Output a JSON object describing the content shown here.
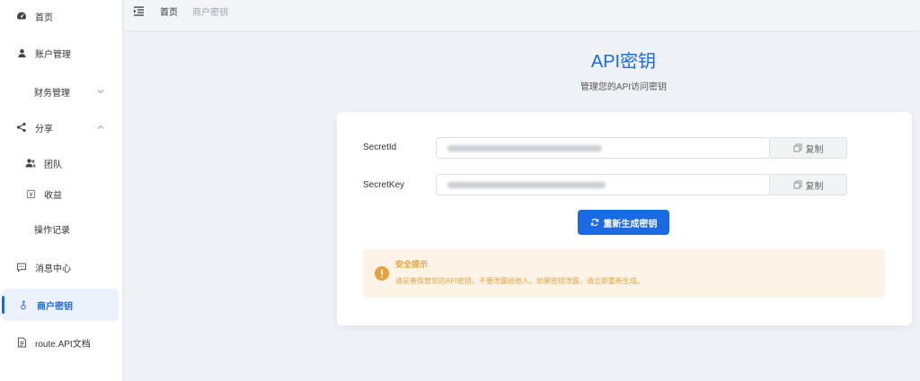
{
  "sidebar": {
    "items": [
      {
        "label": "首页",
        "icon": "dashboard-icon"
      },
      {
        "label": "账户管理",
        "icon": "user-icon"
      },
      {
        "label": "财务管理",
        "icon": "",
        "chevron": "chevron-down-icon"
      },
      {
        "label": "分享",
        "icon": "share-icon",
        "chevron": "chevron-up-icon"
      },
      {
        "label": "团队",
        "icon": "team-icon"
      },
      {
        "label": "收益",
        "icon": "earnings-icon"
      },
      {
        "label": "操作记录",
        "icon": ""
      },
      {
        "label": "消息中心",
        "icon": "message-icon"
      },
      {
        "label": "商户密钥",
        "icon": "key-icon",
        "active": true
      },
      {
        "label": "route.API文档",
        "icon": "document-icon"
      }
    ]
  },
  "topbar": {
    "breadcrumb": [
      "首页",
      "商户密钥"
    ]
  },
  "header": {
    "title": "API密钥",
    "subtitle": "管理您的API访问密钥"
  },
  "form": {
    "secret_id_label": "SecretId",
    "secret_key_label": "SecretKey",
    "copy_label": "复制",
    "regenerate_label": "重新生成密钥"
  },
  "alert": {
    "title": "安全提示",
    "text": "请妥善保管您的API密钥，不要泄露给他人。如果密钥泄露，请立即重新生成。"
  },
  "colors": {
    "accent": "#1a6ae6",
    "warning": "#e6a23c",
    "warning_bg": "#fdf4e7"
  }
}
